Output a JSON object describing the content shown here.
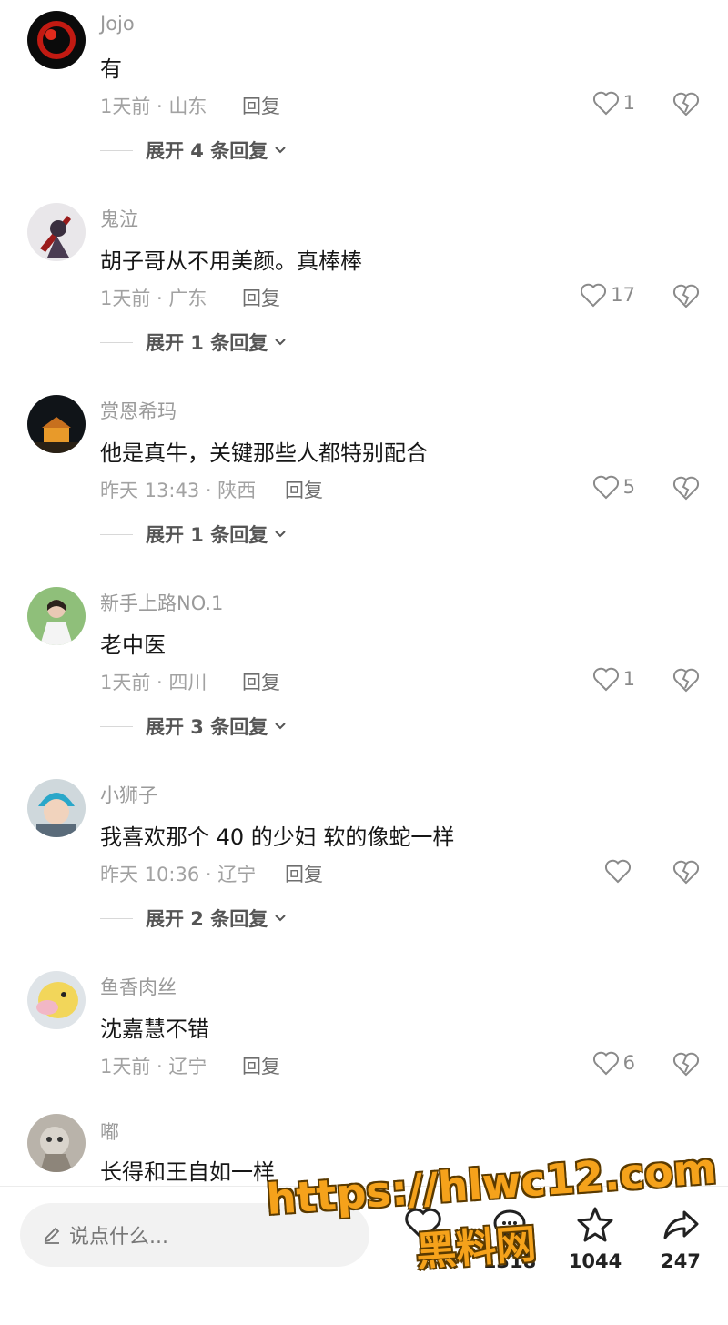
{
  "comments": [
    {
      "username": "Jojo",
      "text": "有",
      "time": "1天前 · 山东",
      "reply": "回复",
      "likes": "1",
      "expand": "展开 4 条回复"
    },
    {
      "username": "鬼泣",
      "text": "胡子哥从不用美颜。真棒棒",
      "time": "1天前 · 广东",
      "reply": "回复",
      "likes": "17",
      "expand": "展开 1 条回复"
    },
    {
      "username": "赏恩希玛",
      "text": "他是真牛，关键那些人都特别配合",
      "time": "昨天 13:43 · 陕西",
      "reply": "回复",
      "likes": "5",
      "expand": "展开 1 条回复"
    },
    {
      "username": "新手上路NO.1",
      "text": "老中医",
      "time": "1天前 · 四川",
      "reply": "回复",
      "likes": "1",
      "expand": "展开 3 条回复"
    },
    {
      "username": "小狮子",
      "text": "我喜欢那个 40 的少妇 软的像蛇一样",
      "time": "昨天 10:36 · 辽宁",
      "reply": "回复",
      "likes": "",
      "expand": "展开 2 条回复"
    },
    {
      "username": "鱼香肉丝",
      "text": "沈嘉慧不错",
      "time": "1天前 · 辽宁",
      "reply": "回复",
      "likes": "6",
      "expand": ""
    },
    {
      "username": "嘟",
      "text": "长得和王自如一样",
      "time": "",
      "reply": "",
      "likes": "",
      "expand": ""
    }
  ],
  "bottom_bar": {
    "input_placeholder": "说点什么...",
    "like_count": "2",
    "comment_count": "1318",
    "favorite_count": "1044",
    "share_count": "247"
  },
  "watermark": {
    "url": "https://hlwc12.com",
    "name": "黑料网"
  },
  "icons": {
    "like": "heart-outline-icon",
    "dislike": "broken-heart-icon",
    "expand": "chevron-down-icon",
    "input": "pencil-icon",
    "favorite": "star-icon",
    "share": "share-arrow-icon",
    "comment": "comment-bubble-icon"
  }
}
